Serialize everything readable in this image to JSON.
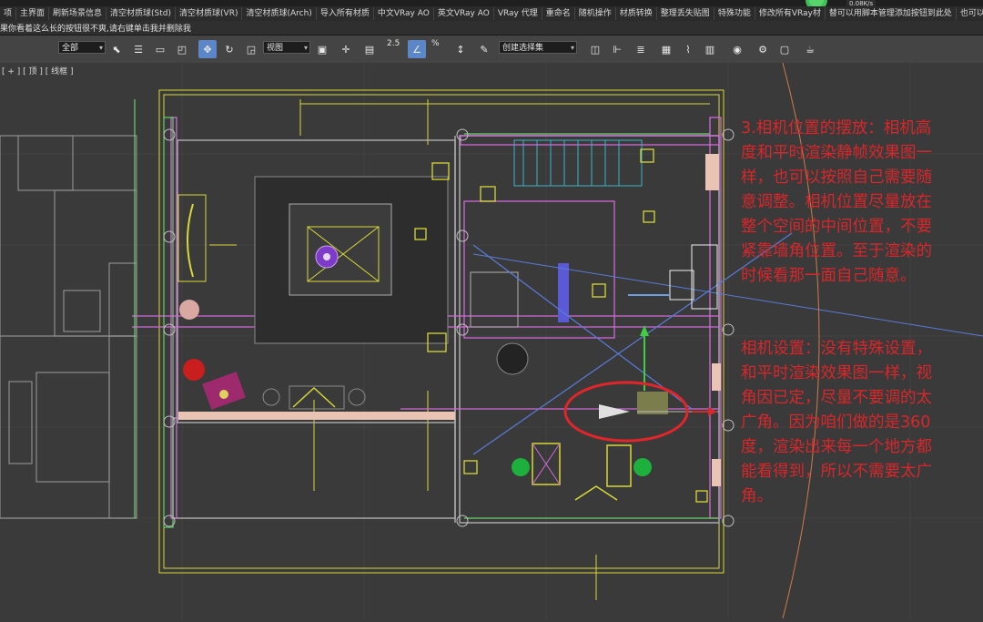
{
  "command_bar": {
    "items": [
      "项",
      "主界面",
      "刷新场景信息",
      "清空材质球(Std)",
      "清空材质球(VR)",
      "清空材质球(Arch)",
      "导入所有材质",
      "中文VRay AO",
      "英文VRay AO",
      "VRay 代理",
      "重命名",
      "随机操作",
      "材质转换",
      "整理丢失贴图",
      "特殊功能",
      "修改所有VRay材",
      "替可以用脚本管理添加按钮到此处",
      "也可以在选项"
    ]
  },
  "hint_bar": {
    "text": "果你看着这么长的按钮很不爽,请右键单击我并删除我"
  },
  "toolbar": {
    "selection_filter": "全部",
    "ref_coord": "视图",
    "snap_value": "2.5",
    "named_selection": "创建选择集",
    "percent_snap": "%"
  },
  "network_speed": "0.08K/s",
  "viewport": {
    "label": "[ + ] [ 顶 ] [ 线框 ]"
  },
  "annotations": {
    "note1": [
      "3.相机位置的摆放：相机高",
      "度和平时渲染静帧效果图一",
      "样，也可以按照自己需要随",
      "意调整。相机位置尽量放在",
      "整个空间的中间位置，不要",
      "紧靠墙角位置。至于渲染的",
      "时候看那一面自己随意。"
    ],
    "note2": [
      "相机设置：没有特殊设置，",
      "和平时渲染效果图一样，视",
      "角因已定，尽量不要调的太",
      "广角。因为咱们做的是360",
      "度，渲染出来每一个地方都",
      "能看得到，所以不需要太广",
      "角。"
    ]
  },
  "colors": {
    "note_red": "#d8262a",
    "highlight_circle": "#e0262a",
    "wall_yellow": "#d8d838",
    "wall_magenta": "#d06ad8",
    "wall_green": "#6ad06a",
    "wall_gray": "#8a8a8a"
  }
}
